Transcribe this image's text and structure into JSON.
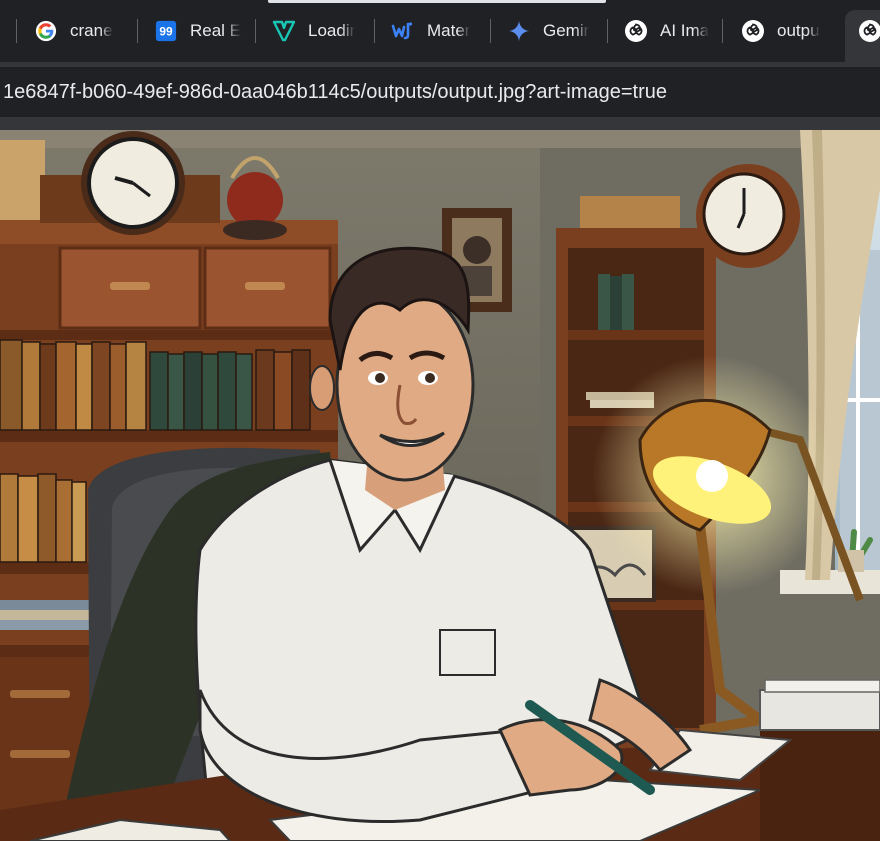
{
  "browser": {
    "tabs": [
      {
        "label": "crane",
        "icon": "google-g-icon"
      },
      {
        "label": "Real E",
        "icon": "ninety-nine-icon",
        "badge": "99"
      },
      {
        "label": "Loadir",
        "icon": "v-logo-icon"
      },
      {
        "label": "Mater",
        "icon": "mj-logo-icon"
      },
      {
        "label": "Gemir",
        "icon": "sparkle-icon"
      },
      {
        "label": "AI Ima",
        "icon": "openai-icon"
      },
      {
        "label": "outpu",
        "icon": "openai-icon"
      },
      {
        "label": "",
        "icon": "openai-icon"
      }
    ],
    "address": "1e6847f-b060-49ef-986d-0aa046b114c5/outputs/output.jpg?art-image=true"
  },
  "colors": {
    "tab_bg": "#202124",
    "toolbar_bg": "#35363a",
    "google_blue": "#4285f4",
    "gemini_blue": "#5b8def",
    "v_teal": "#18c6b5"
  }
}
